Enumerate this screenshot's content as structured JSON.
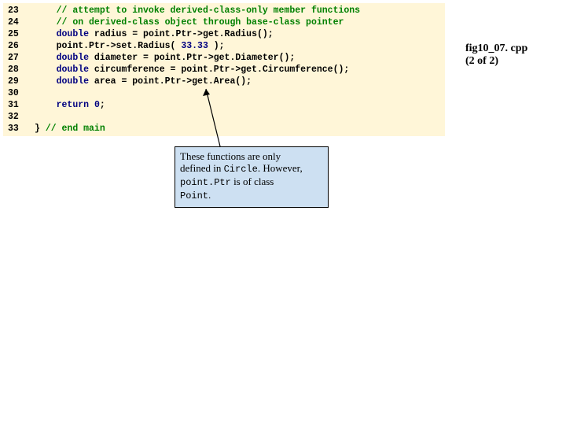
{
  "caption": {
    "line1": "fig10_07. cpp",
    "line2": "(2 of 2)"
  },
  "callout": {
    "t1": "These functions are only",
    "t2": "defined in ",
    "t2b": "Circle",
    "t2c": ". However,",
    "t3a": "point.Ptr",
    "t3b": " is of class",
    "t4": "Point",
    "t4b": "."
  },
  "code": {
    "l23": {
      "n": "23",
      "indent": "    ",
      "c": "// attempt to invoke derived-class-only member functions"
    },
    "l24": {
      "n": "24",
      "indent": "    ",
      "c": "// on derived-class object through base-class pointer"
    },
    "l25": {
      "n": "25",
      "indent": "    ",
      "k": "double",
      "r": " radius = point.Ptr->get.Radius();"
    },
    "l26": {
      "n": "26",
      "indent": "    ",
      "r": "point.Ptr->set.Radius( ",
      "num": "33.33",
      "r2": " );"
    },
    "l27": {
      "n": "27",
      "indent": "    ",
      "k": "double",
      "r": " diameter = point.Ptr->get.Diameter();"
    },
    "l28": {
      "n": "28",
      "indent": "    ",
      "k": "double",
      "r": " circumference = point.Ptr->get.Circumference();"
    },
    "l29": {
      "n": "29",
      "indent": "    ",
      "k": "double",
      "r": " area = point.Ptr->get.Area();"
    },
    "l30": {
      "n": "30",
      "indent": ""
    },
    "l31": {
      "n": "31",
      "indent": "    ",
      "k": "return",
      "sp": " ",
      "num": "0",
      "r": ";"
    },
    "l32": {
      "n": "32",
      "indent": ""
    },
    "l33": {
      "n": "33",
      "brace": "} ",
      "c": "// end main"
    }
  }
}
